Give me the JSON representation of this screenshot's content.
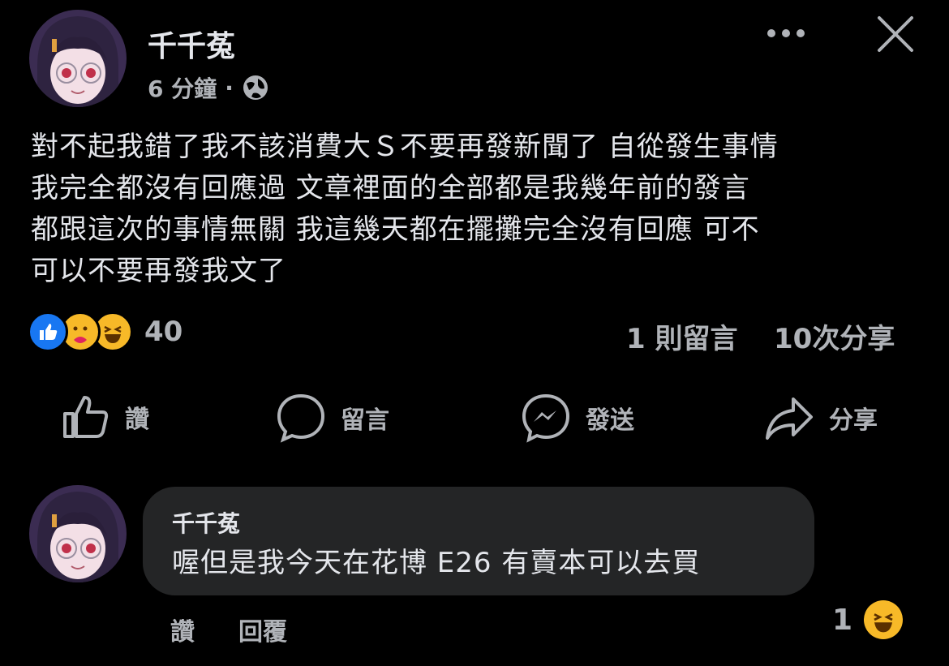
{
  "post": {
    "author": "千千菟",
    "time": "6 分鐘",
    "visibility_icon": "globe-icon",
    "text_lines": [
      "對不起我錯了我不該消費大Ｓ不要再發新聞了 自從發生事情",
      "我完全都沒有回應過 文章裡面的全部都是我幾年前的發言",
      "都跟這次的事情無關 我這幾天都在擺攤完全沒有回應 可不",
      "可以不要再發我文了"
    ],
    "reaction_count": "40",
    "comments_count": "1 則留言",
    "shares_count": "10次分享"
  },
  "actions": {
    "like": "讚",
    "comment": "留言",
    "send": "發送",
    "share": "分享"
  },
  "comment": {
    "author": "千千菟",
    "text": "喔但是我今天在花博 E26 有賣本可以去買",
    "like": "讚",
    "reply": "回覆",
    "reaction_count": "1"
  },
  "colors": {
    "background": "#000000",
    "bubble": "#242526",
    "text": "#e4e6eb",
    "muted": "#b0b3b8",
    "like_blue": "#1877f2",
    "emoji_yellow": "#f7b928"
  }
}
